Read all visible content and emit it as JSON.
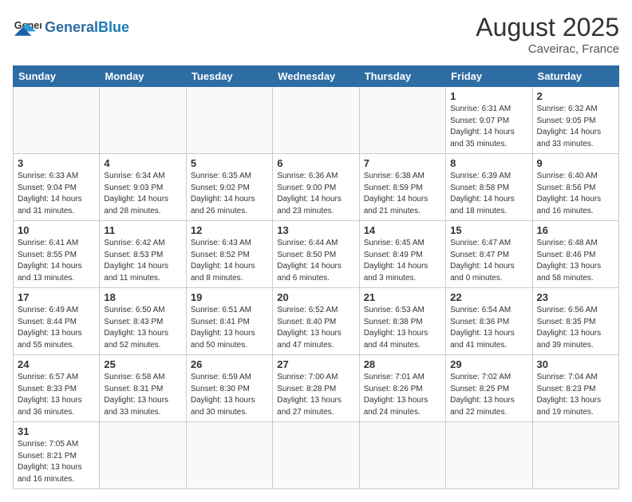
{
  "header": {
    "logo_general": "General",
    "logo_blue": "Blue",
    "month_year": "August 2025",
    "location": "Caveirac, France"
  },
  "days_of_week": [
    "Sunday",
    "Monday",
    "Tuesday",
    "Wednesday",
    "Thursday",
    "Friday",
    "Saturday"
  ],
  "weeks": [
    [
      {
        "day": "",
        "info": ""
      },
      {
        "day": "",
        "info": ""
      },
      {
        "day": "",
        "info": ""
      },
      {
        "day": "",
        "info": ""
      },
      {
        "day": "",
        "info": ""
      },
      {
        "day": "1",
        "info": "Sunrise: 6:31 AM\nSunset: 9:07 PM\nDaylight: 14 hours and 35 minutes."
      },
      {
        "day": "2",
        "info": "Sunrise: 6:32 AM\nSunset: 9:05 PM\nDaylight: 14 hours and 33 minutes."
      }
    ],
    [
      {
        "day": "3",
        "info": "Sunrise: 6:33 AM\nSunset: 9:04 PM\nDaylight: 14 hours and 31 minutes."
      },
      {
        "day": "4",
        "info": "Sunrise: 6:34 AM\nSunset: 9:03 PM\nDaylight: 14 hours and 28 minutes."
      },
      {
        "day": "5",
        "info": "Sunrise: 6:35 AM\nSunset: 9:02 PM\nDaylight: 14 hours and 26 minutes."
      },
      {
        "day": "6",
        "info": "Sunrise: 6:36 AM\nSunset: 9:00 PM\nDaylight: 14 hours and 23 minutes."
      },
      {
        "day": "7",
        "info": "Sunrise: 6:38 AM\nSunset: 8:59 PM\nDaylight: 14 hours and 21 minutes."
      },
      {
        "day": "8",
        "info": "Sunrise: 6:39 AM\nSunset: 8:58 PM\nDaylight: 14 hours and 18 minutes."
      },
      {
        "day": "9",
        "info": "Sunrise: 6:40 AM\nSunset: 8:56 PM\nDaylight: 14 hours and 16 minutes."
      }
    ],
    [
      {
        "day": "10",
        "info": "Sunrise: 6:41 AM\nSunset: 8:55 PM\nDaylight: 14 hours and 13 minutes."
      },
      {
        "day": "11",
        "info": "Sunrise: 6:42 AM\nSunset: 8:53 PM\nDaylight: 14 hours and 11 minutes."
      },
      {
        "day": "12",
        "info": "Sunrise: 6:43 AM\nSunset: 8:52 PM\nDaylight: 14 hours and 8 minutes."
      },
      {
        "day": "13",
        "info": "Sunrise: 6:44 AM\nSunset: 8:50 PM\nDaylight: 14 hours and 6 minutes."
      },
      {
        "day": "14",
        "info": "Sunrise: 6:45 AM\nSunset: 8:49 PM\nDaylight: 14 hours and 3 minutes."
      },
      {
        "day": "15",
        "info": "Sunrise: 6:47 AM\nSunset: 8:47 PM\nDaylight: 14 hours and 0 minutes."
      },
      {
        "day": "16",
        "info": "Sunrise: 6:48 AM\nSunset: 8:46 PM\nDaylight: 13 hours and 58 minutes."
      }
    ],
    [
      {
        "day": "17",
        "info": "Sunrise: 6:49 AM\nSunset: 8:44 PM\nDaylight: 13 hours and 55 minutes."
      },
      {
        "day": "18",
        "info": "Sunrise: 6:50 AM\nSunset: 8:43 PM\nDaylight: 13 hours and 52 minutes."
      },
      {
        "day": "19",
        "info": "Sunrise: 6:51 AM\nSunset: 8:41 PM\nDaylight: 13 hours and 50 minutes."
      },
      {
        "day": "20",
        "info": "Sunrise: 6:52 AM\nSunset: 8:40 PM\nDaylight: 13 hours and 47 minutes."
      },
      {
        "day": "21",
        "info": "Sunrise: 6:53 AM\nSunset: 8:38 PM\nDaylight: 13 hours and 44 minutes."
      },
      {
        "day": "22",
        "info": "Sunrise: 6:54 AM\nSunset: 8:36 PM\nDaylight: 13 hours and 41 minutes."
      },
      {
        "day": "23",
        "info": "Sunrise: 6:56 AM\nSunset: 8:35 PM\nDaylight: 13 hours and 39 minutes."
      }
    ],
    [
      {
        "day": "24",
        "info": "Sunrise: 6:57 AM\nSunset: 8:33 PM\nDaylight: 13 hours and 36 minutes."
      },
      {
        "day": "25",
        "info": "Sunrise: 6:58 AM\nSunset: 8:31 PM\nDaylight: 13 hours and 33 minutes."
      },
      {
        "day": "26",
        "info": "Sunrise: 6:59 AM\nSunset: 8:30 PM\nDaylight: 13 hours and 30 minutes."
      },
      {
        "day": "27",
        "info": "Sunrise: 7:00 AM\nSunset: 8:28 PM\nDaylight: 13 hours and 27 minutes."
      },
      {
        "day": "28",
        "info": "Sunrise: 7:01 AM\nSunset: 8:26 PM\nDaylight: 13 hours and 24 minutes."
      },
      {
        "day": "29",
        "info": "Sunrise: 7:02 AM\nSunset: 8:25 PM\nDaylight: 13 hours and 22 minutes."
      },
      {
        "day": "30",
        "info": "Sunrise: 7:04 AM\nSunset: 8:23 PM\nDaylight: 13 hours and 19 minutes."
      }
    ],
    [
      {
        "day": "31",
        "info": "Sunrise: 7:05 AM\nSunset: 8:21 PM\nDaylight: 13 hours and 16 minutes."
      },
      {
        "day": "",
        "info": ""
      },
      {
        "day": "",
        "info": ""
      },
      {
        "day": "",
        "info": ""
      },
      {
        "day": "",
        "info": ""
      },
      {
        "day": "",
        "info": ""
      },
      {
        "day": "",
        "info": ""
      }
    ]
  ]
}
